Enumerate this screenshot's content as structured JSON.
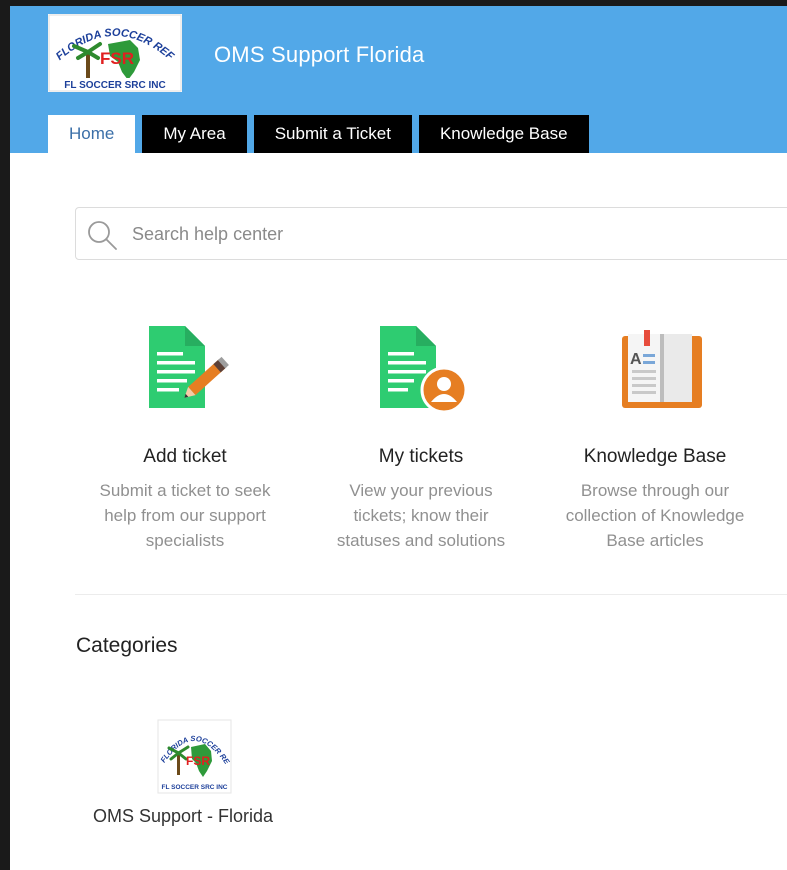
{
  "header": {
    "portal_title": "OMS Support Florida",
    "logo_text_top": "FLORIDA SOCCER REFEREES",
    "logo_text_bottom": "FL SOCCER SRC INC",
    "logo_mark": "FSR"
  },
  "tabs": [
    {
      "label": "Home",
      "active": true
    },
    {
      "label": "My Area",
      "active": false
    },
    {
      "label": "Submit a Ticket",
      "active": false
    },
    {
      "label": "Knowledge Base",
      "active": false
    }
  ],
  "search": {
    "placeholder": "Search help center",
    "icon": "search-icon"
  },
  "cards": [
    {
      "title": "Add ticket",
      "desc_lines": [
        "Submit a ticket to seek",
        "help from our support",
        "specialists"
      ],
      "icon": "add-ticket-icon"
    },
    {
      "title": "My tickets",
      "desc_lines": [
        "View your previous",
        "tickets; know their",
        "statuses and solutions"
      ],
      "icon": "my-tickets-icon"
    },
    {
      "title": "Knowledge Base",
      "desc_lines": [
        "Browse through our",
        "collection of Knowledge",
        "Base articles"
      ],
      "icon": "book-icon"
    }
  ],
  "categories": {
    "title": "Categories",
    "items": [
      {
        "label": "OMS Support - Florida",
        "logo_text_bottom": "FL SOCCER SRC INC"
      }
    ]
  },
  "colors": {
    "header_bg": "#52a8e8",
    "tab_bg": "#000000",
    "tab_active_text": "#3b6fa8",
    "doc_green": "#2ecc71",
    "accent_orange": "#e67e22"
  }
}
